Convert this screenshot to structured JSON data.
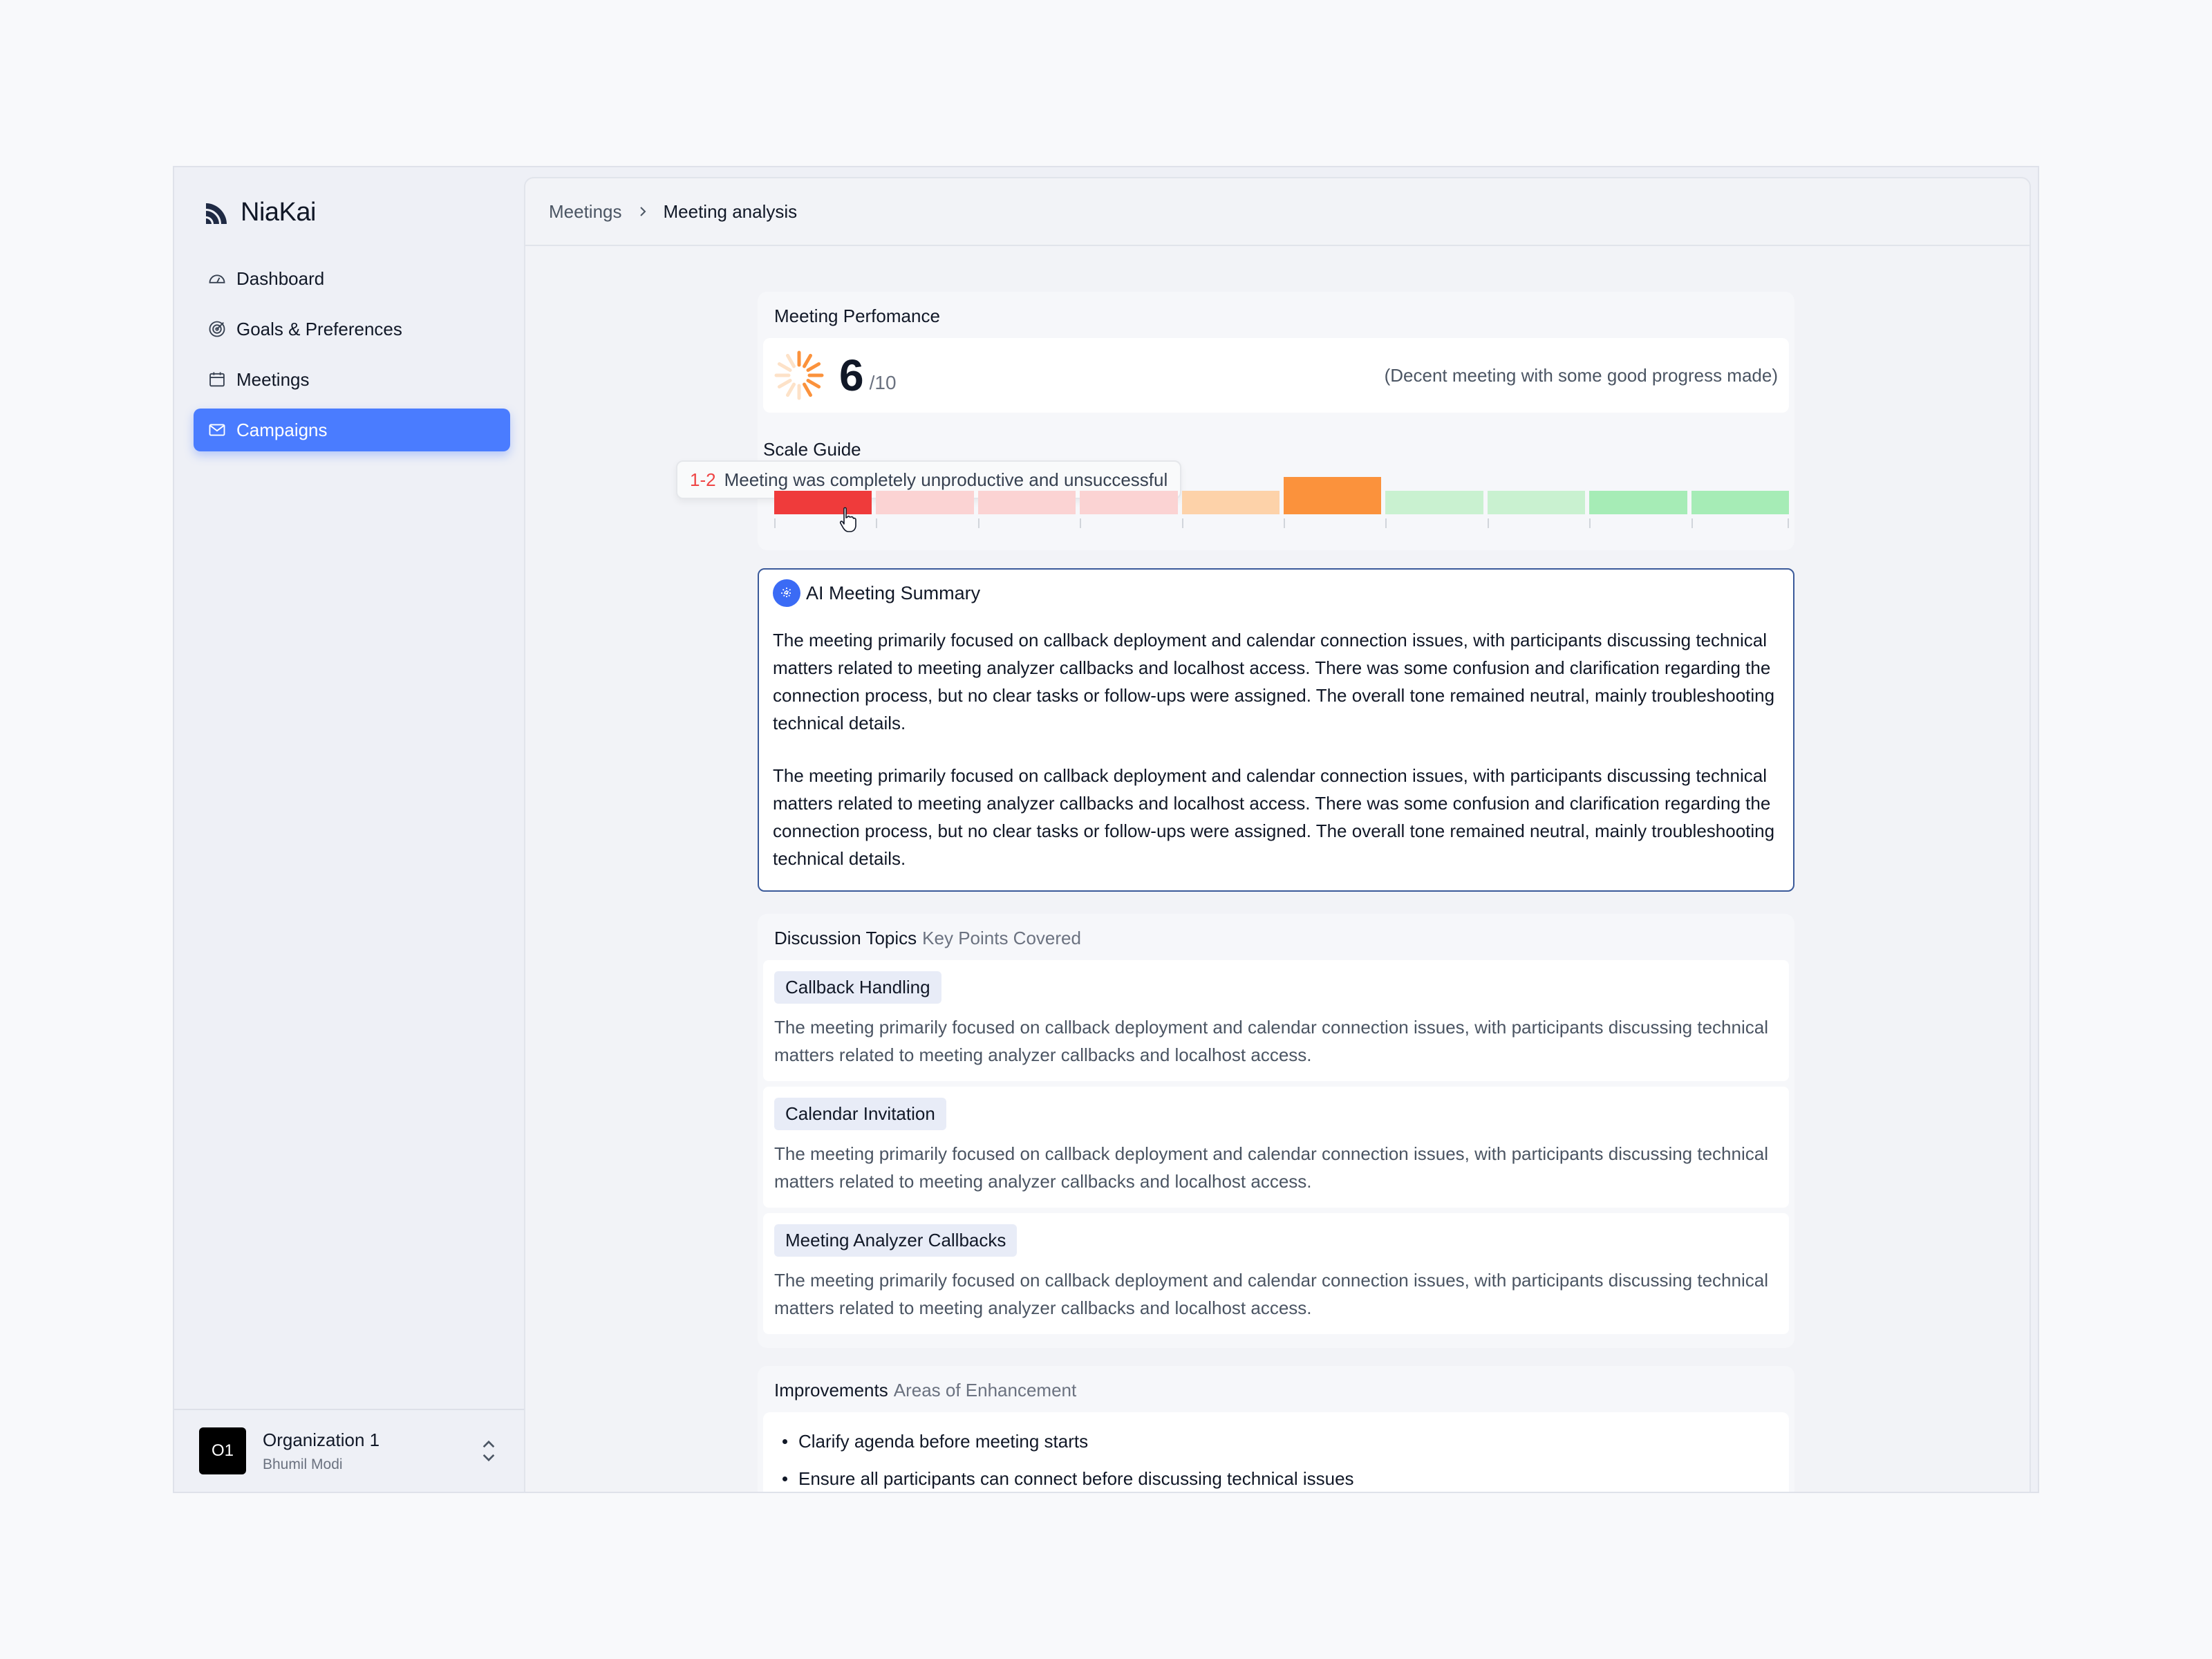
{
  "brand": {
    "name": "NiaKai"
  },
  "sidebar": {
    "items": [
      {
        "label": "Dashboard",
        "icon": "gauge-icon"
      },
      {
        "label": "Goals & Preferences",
        "icon": "target-icon"
      },
      {
        "label": "Meetings",
        "icon": "calendar-icon"
      },
      {
        "label": "Campaigns",
        "icon": "mail-icon",
        "active": true
      }
    ],
    "org": {
      "avatar": "O1",
      "name": "Organization 1",
      "user": "Bhumil Modi"
    }
  },
  "breadcrumb": {
    "parent": "Meetings",
    "current": "Meeting analysis"
  },
  "performance": {
    "title": "Meeting Perfomance",
    "score": "6",
    "denominator": "/10",
    "description": "(Decent meeting with some good progress made)",
    "scale_title": "Scale Guide",
    "scale_colors": [
      "#ef3b3b",
      "#fbd3d3",
      "#fbd3d3",
      "#fbd3d3",
      "#fdd2a9",
      "#fb923c",
      "#c9f1d0",
      "#c9f1d0",
      "#a6ecb6",
      "#a6ecb6"
    ],
    "selected_level": 6,
    "tooltip": {
      "range": "1-2",
      "text": "Meeting was completely unproductive and unsuccessful"
    }
  },
  "summary": {
    "title": "AI Meeting Summary",
    "paragraphs": [
      "The meeting primarily focused on callback deployment and calendar connection issues, with participants discussing technical matters related to meeting analyzer callbacks and localhost access. There was some confusion and clarification regarding the connection process, but no clear tasks or follow-ups were assigned. The overall tone remained neutral, mainly troubleshooting technical details.",
      "The meeting primarily focused on callback deployment and calendar connection issues, with participants discussing technical matters related to meeting analyzer callbacks and localhost access. There was some confusion and clarification regarding the connection process, but no clear tasks or follow-ups were assigned. The overall tone remained neutral, mainly troubleshooting technical details."
    ]
  },
  "topics": {
    "title": "Discussion Topics",
    "subtitle": "Key Points Covered",
    "items": [
      {
        "label": "Callback Handling",
        "text": "The meeting primarily focused on callback deployment and calendar connection issues, with participants discussing technical matters related to meeting analyzer callbacks and localhost access."
      },
      {
        "label": "Calendar Invitation",
        "text": "The meeting primarily focused on callback deployment and calendar connection issues, with participants discussing technical matters related to meeting analyzer callbacks and localhost access."
      },
      {
        "label": "Meeting Analyzer Callbacks",
        "text": "The meeting primarily focused on callback deployment and calendar connection issues, with participants discussing technical matters related to meeting analyzer callbacks and localhost access."
      }
    ]
  },
  "improvements": {
    "title": "Improvements",
    "subtitle": "Areas of Enhancement",
    "items": [
      "Clarify agenda before meeting starts",
      "Ensure all participants can connect before discussing technical issues"
    ]
  }
}
